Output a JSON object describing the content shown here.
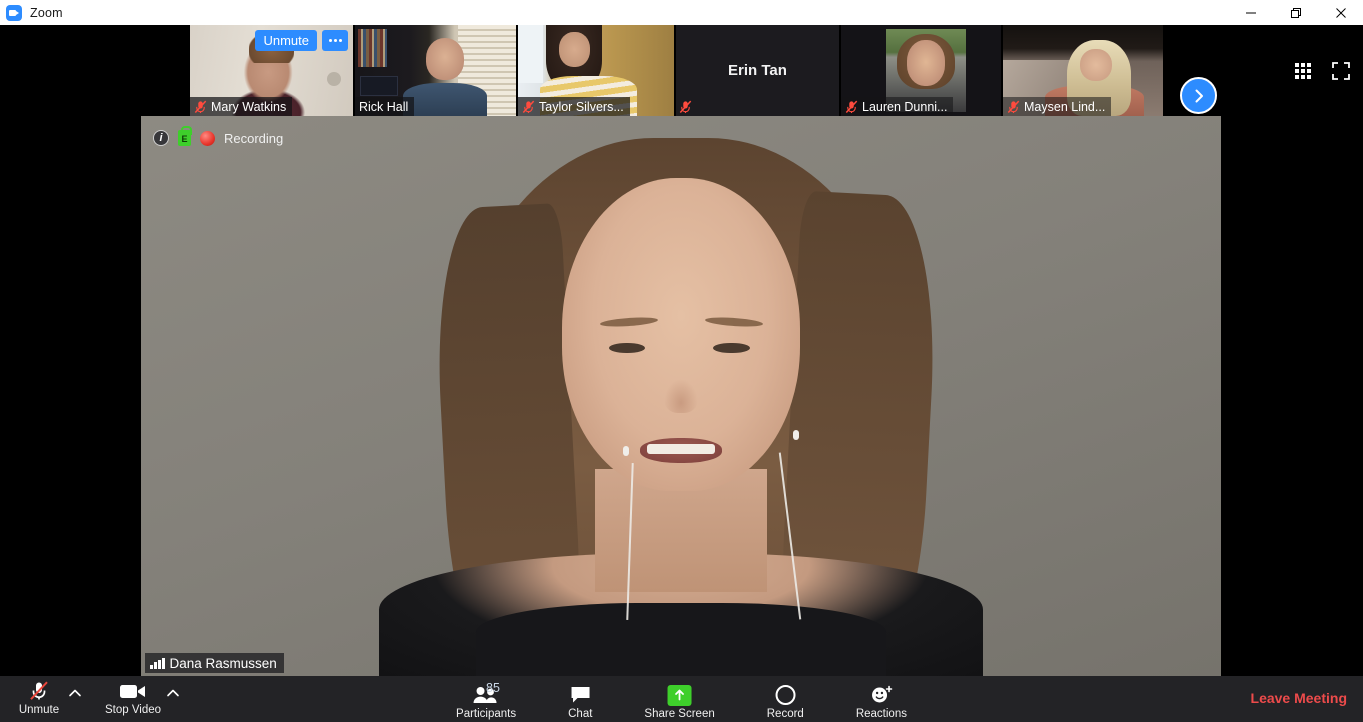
{
  "window": {
    "app_title": "Zoom",
    "logo_icon": "zoom-logo-icon",
    "minimize_label": "Minimize",
    "maximize_label": "Restore",
    "close_label": "Close"
  },
  "filmstrip": {
    "hover_tile": {
      "unmute_label": "Unmute",
      "more_label": "More options"
    },
    "next_page_icon": "chevron-right-icon",
    "grid_view_icon": "grid-view-icon",
    "fullscreen_icon": "fullscreen-icon",
    "participants": [
      {
        "name": "Mary Watkins",
        "muted": true,
        "video_on": true,
        "avatar_only": false
      },
      {
        "name": "Rick Hall",
        "muted": false,
        "video_on": true,
        "avatar_only": false
      },
      {
        "name": "Taylor Silvers...",
        "muted": true,
        "video_on": true,
        "avatar_only": false
      },
      {
        "name": "Erin Tan",
        "muted": true,
        "video_on": false,
        "avatar_only": false
      },
      {
        "name": "Lauren Dunni...",
        "muted": true,
        "video_on": false,
        "avatar_only": true
      },
      {
        "name": "Maysen Lind...",
        "muted": true,
        "video_on": true,
        "avatar_only": false
      }
    ]
  },
  "stage": {
    "info_icon": "info-icon",
    "encryption_badge_letter": "E",
    "encryption_icon": "lock-encrypted-icon",
    "recording_icon": "record-dot-icon",
    "recording_label": "Recording",
    "active_speaker": "Dana Rasmussen",
    "audio_icon": "audio-level-bars-icon"
  },
  "toolbar": {
    "mic": {
      "label": "Unmute",
      "icon": "microphone-muted-icon",
      "caret_icon": "chevron-up-icon"
    },
    "video": {
      "label": "Stop Video",
      "icon": "video-camera-icon",
      "caret_icon": "chevron-up-icon"
    },
    "participants": {
      "label": "Participants",
      "icon": "participants-icon",
      "count": "85"
    },
    "chat": {
      "label": "Chat",
      "icon": "chat-bubble-icon"
    },
    "share": {
      "label": "Share Screen",
      "icon": "share-screen-up-arrow-icon"
    },
    "record": {
      "label": "Record",
      "icon": "record-circle-icon"
    },
    "reactions": {
      "label": "Reactions",
      "icon": "reactions-smiley-icon"
    },
    "leave": {
      "label": "Leave Meeting"
    }
  },
  "colors": {
    "zoom_blue": "#2D8CFF",
    "leave_red": "#ED4B4B",
    "share_green": "#3ECF2B",
    "toolbar_bg": "#232326"
  }
}
